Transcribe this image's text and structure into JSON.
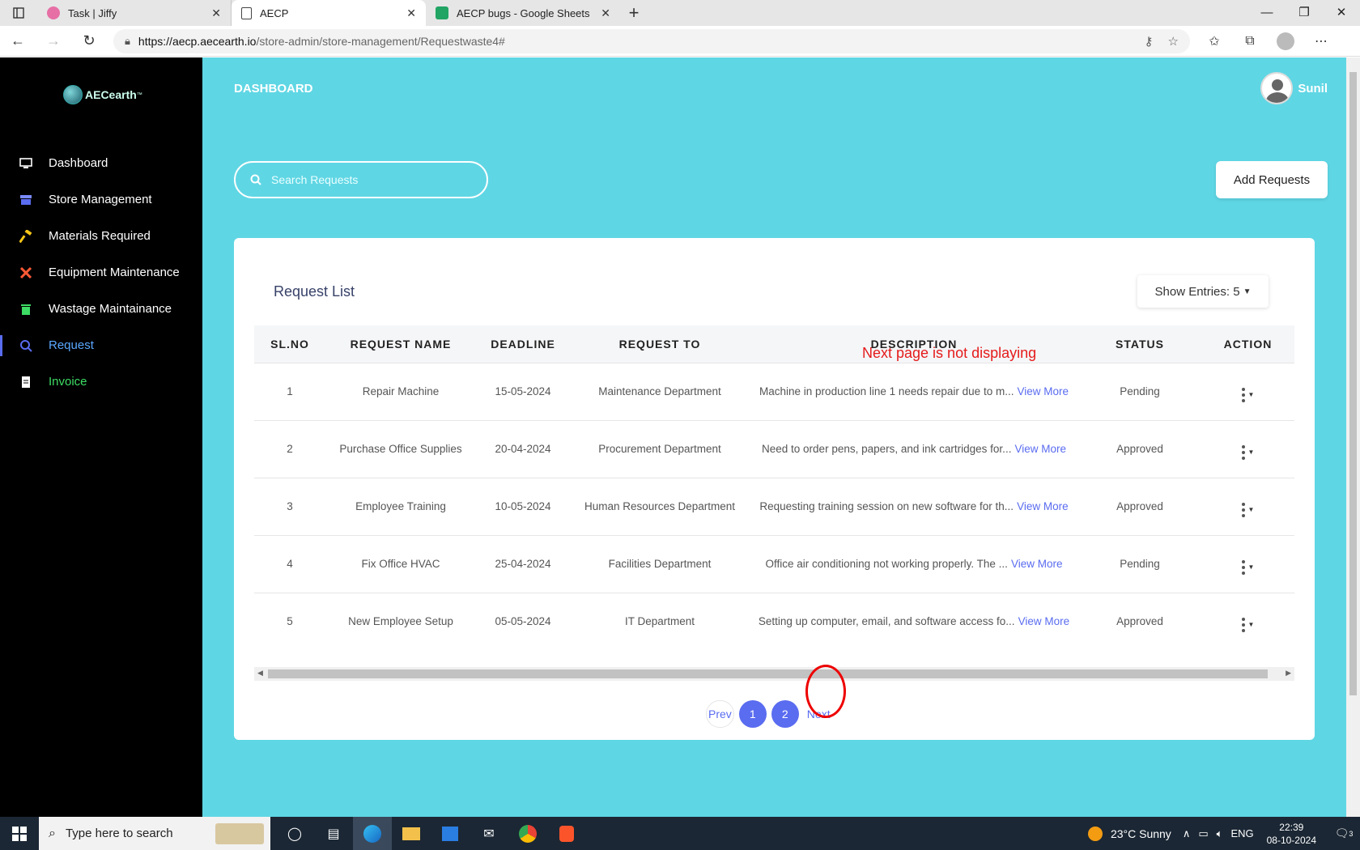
{
  "browser": {
    "tabs": [
      {
        "title": "Task | Jiffy",
        "active": false,
        "fav_color": "#e66fa6"
      },
      {
        "title": "AECP",
        "active": true,
        "fav_color": "#ffffff"
      },
      {
        "title": "AECP bugs - Google Sheets",
        "active": false,
        "fav_color": "#21a464"
      }
    ],
    "url_host": "https://aecp.aecearth.io",
    "url_path": "/store-admin/store-management/Requestwaste4#"
  },
  "sidebar": {
    "logo_text": "AECearth",
    "logo_tm": "™",
    "items": [
      {
        "label": "Dashboard",
        "icon": "monitor-icon"
      },
      {
        "label": "Store Management",
        "icon": "store-icon"
      },
      {
        "label": "Materials Required",
        "icon": "hammer-icon"
      },
      {
        "label": "Equipment Maintenance",
        "icon": "tools-icon"
      },
      {
        "label": "Wastage Maintainance",
        "icon": "trash-icon"
      },
      {
        "label": "Request",
        "icon": "request-icon"
      },
      {
        "label": "Invoice",
        "icon": "invoice-icon"
      }
    ]
  },
  "header": {
    "title": "DASHBOARD",
    "user": "Sunil"
  },
  "search": {
    "placeholder": "Search Requests"
  },
  "add_button": "Add Requests",
  "card": {
    "title": "Request List",
    "entries_label": "Show Entries: 5",
    "columns": [
      "SL.NO",
      "REQUEST NAME",
      "DEADLINE",
      "REQUEST TO",
      "DESCRIPTION",
      "STATUS",
      "ACTION"
    ],
    "view_more": "View More",
    "rows": [
      {
        "sl": "1",
        "name": "Repair Machine",
        "deadline": "15-05-2024",
        "to": "Maintenance Department",
        "desc": "Machine in production line 1 needs repair due to m...",
        "status": "Pending"
      },
      {
        "sl": "2",
        "name": "Purchase Office Supplies",
        "deadline": "20-04-2024",
        "to": "Procurement Department",
        "desc": "Need to order pens, papers, and ink cartridges for...",
        "status": "Approved"
      },
      {
        "sl": "3",
        "name": "Employee Training",
        "deadline": "10-05-2024",
        "to": "Human Resources Department",
        "desc": "Requesting training session on new software for th...",
        "status": "Approved"
      },
      {
        "sl": "4",
        "name": "Fix Office HVAC",
        "deadline": "25-04-2024",
        "to": "Facilities Department",
        "desc": "Office air conditioning not working properly. The ...",
        "status": "Pending"
      },
      {
        "sl": "5",
        "name": "New Employee Setup",
        "deadline": "05-05-2024",
        "to": "IT Department",
        "desc": "Setting up computer, email, and software access fo...",
        "status": "Approved"
      }
    ],
    "pagination": {
      "prev": "Prev",
      "pages": [
        "1",
        "2"
      ],
      "next": "Next"
    }
  },
  "annotation": {
    "text": "Next page is not displaying",
    "color": "#e51b1b"
  },
  "taskbar": {
    "search_placeholder": "Type here to search",
    "weather": "23°C  Sunny",
    "lang": "ENG",
    "time": "22:39",
    "date": "08-10-2024",
    "notif_count": "3"
  },
  "colors": {
    "sidebar": "#000000",
    "main_bg": "#5fd6e4",
    "accent": "#5a6cf0",
    "invoice": "#3ddc64"
  }
}
